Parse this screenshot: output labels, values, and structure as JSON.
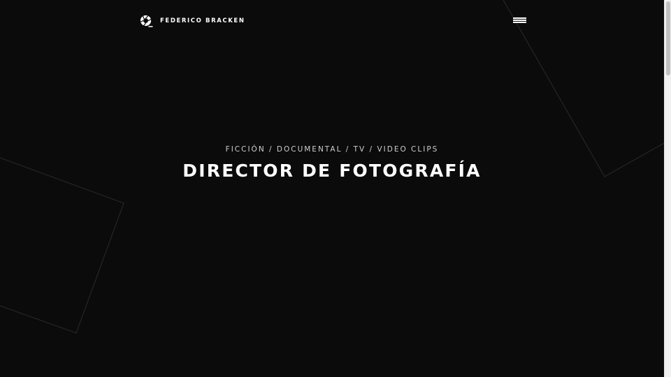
{
  "header": {
    "brand_name": "FEDERICO BRACKEN",
    "logo_icon": "camera-aperture-icon",
    "menu_icon": "hamburger-menu-icon"
  },
  "hero": {
    "subtitle": "FICCIÓN / DOCUMENTAL / TV / VIDEO CLIPS",
    "title": "DIRECTOR DE FOTOGRAFÍA"
  },
  "colors": {
    "background": "#0b0b0b",
    "text": "#ffffff",
    "subtitle_text": "#cfcfcf",
    "decor_line": "#2a2a2a"
  }
}
